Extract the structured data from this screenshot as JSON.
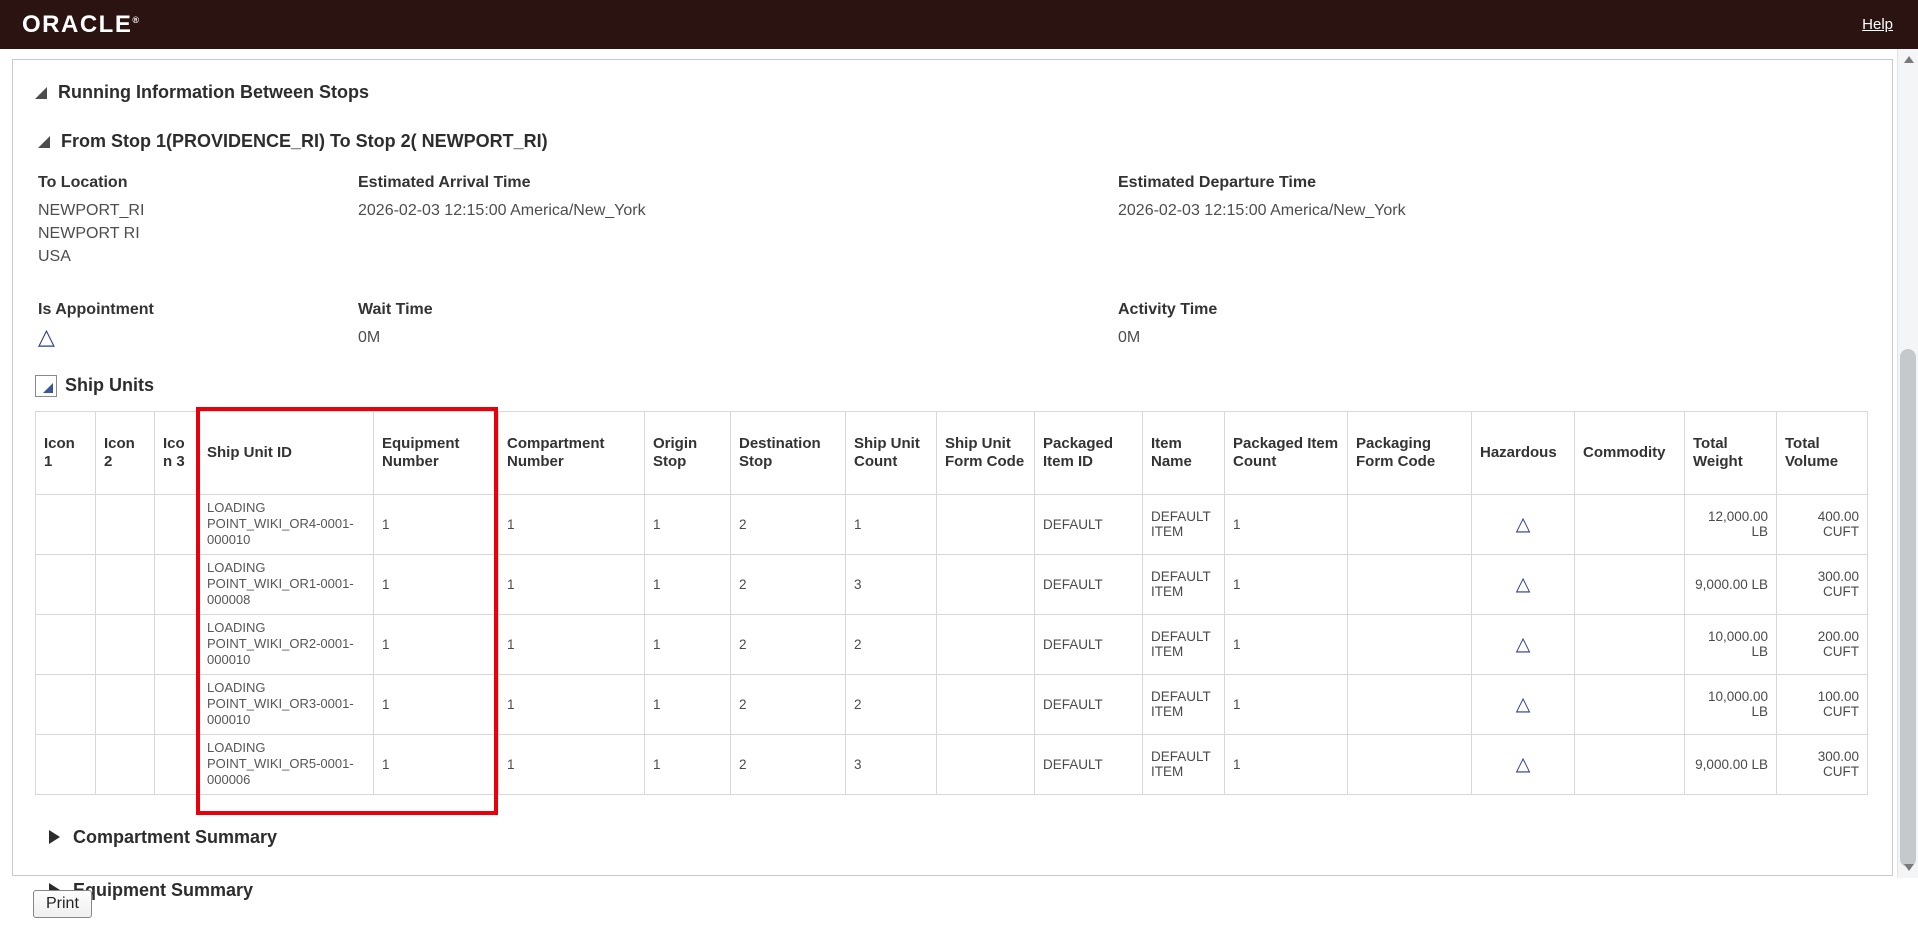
{
  "header": {
    "brand": "ORACLE",
    "registered": "®",
    "help": "Help"
  },
  "sections": {
    "running_info": "Running Information Between Stops",
    "stops": "From Stop 1(PROVIDENCE_RI) To Stop 2( NEWPORT_RI)",
    "ship_units": "Ship Units",
    "compartment_summary": "Compartment Summary",
    "equipment_summary": "Equipment Summary"
  },
  "details": {
    "to_location": {
      "label": "To Location",
      "lines": [
        "NEWPORT_RI",
        "NEWPORT RI",
        "USA"
      ]
    },
    "estimated_arrival": {
      "label": "Estimated Arrival Time",
      "value": "2026-02-03 12:15:00 America/New_York"
    },
    "estimated_departure": {
      "label": "Estimated Departure Time",
      "value": "2026-02-03 12:15:00 America/New_York"
    },
    "is_appointment": {
      "label": "Is Appointment",
      "icon": "triangle"
    },
    "wait_time": {
      "label": "Wait Time",
      "value": "0M"
    },
    "activity_time": {
      "label": "Activity Time",
      "value": "0M"
    }
  },
  "icons": {
    "triangle": "△"
  },
  "table": {
    "columns": [
      "Icon 1",
      "Icon 2",
      "Icon 3",
      "Ship Unit ID",
      "Equipment Number",
      "Compartment Number",
      "Origin Stop",
      "Destination Stop",
      "Ship Unit Count",
      "Ship Unit Form Code",
      "Packaged Item ID",
      "Item Name",
      "Packaged Item Count",
      "Packaging Form Code",
      "Hazardous",
      "Commodity",
      "Total Weight",
      "Total Volume"
    ],
    "rows": [
      {
        "icon1": "",
        "icon2": "",
        "icon3": "",
        "ship_unit_id": "LOADING POINT_WIKI_OR4-0001-000010",
        "equipment_number": "1",
        "compartment_number": "1",
        "origin_stop": "1",
        "destination_stop": "2",
        "ship_unit_count": "1",
        "ship_unit_form_code": "",
        "packaged_item_id": "DEFAULT",
        "item_name": "DEFAULT ITEM",
        "packaged_item_count": "1",
        "packaging_form_code": "",
        "hazardous_icon": "triangle",
        "commodity": "",
        "total_weight": "12,000.00 LB",
        "total_volume": "400.00 CUFT"
      },
      {
        "icon1": "",
        "icon2": "",
        "icon3": "",
        "ship_unit_id": "LOADING POINT_WIKI_OR1-0001-000008",
        "equipment_number": "1",
        "compartment_number": "1",
        "origin_stop": "1",
        "destination_stop": "2",
        "ship_unit_count": "3",
        "ship_unit_form_code": "",
        "packaged_item_id": "DEFAULT",
        "item_name": "DEFAULT ITEM",
        "packaged_item_count": "1",
        "packaging_form_code": "",
        "hazardous_icon": "triangle",
        "commodity": "",
        "total_weight": "9,000.00 LB",
        "total_volume": "300.00 CUFT"
      },
      {
        "icon1": "",
        "icon2": "",
        "icon3": "",
        "ship_unit_id": "LOADING POINT_WIKI_OR2-0001-000010",
        "equipment_number": "1",
        "compartment_number": "1",
        "origin_stop": "1",
        "destination_stop": "2",
        "ship_unit_count": "2",
        "ship_unit_form_code": "",
        "packaged_item_id": "DEFAULT",
        "item_name": "DEFAULT ITEM",
        "packaged_item_count": "1",
        "packaging_form_code": "",
        "hazardous_icon": "triangle",
        "commodity": "",
        "total_weight": "10,000.00 LB",
        "total_volume": "200.00 CUFT"
      },
      {
        "icon1": "",
        "icon2": "",
        "icon3": "",
        "ship_unit_id": "LOADING POINT_WIKI_OR3-0001-000010",
        "equipment_number": "1",
        "compartment_number": "1",
        "origin_stop": "1",
        "destination_stop": "2",
        "ship_unit_count": "2",
        "ship_unit_form_code": "",
        "packaged_item_id": "DEFAULT",
        "item_name": "DEFAULT ITEM",
        "packaged_item_count": "1",
        "packaging_form_code": "",
        "hazardous_icon": "triangle",
        "commodity": "",
        "total_weight": "10,000.00 LB",
        "total_volume": "100.00 CUFT"
      },
      {
        "icon1": "",
        "icon2": "",
        "icon3": "",
        "ship_unit_id": "LOADING POINT_WIKI_OR5-0001-000006",
        "equipment_number": "1",
        "compartment_number": "1",
        "origin_stop": "1",
        "destination_stop": "2",
        "ship_unit_count": "3",
        "ship_unit_form_code": "",
        "packaged_item_id": "DEFAULT",
        "item_name": "DEFAULT ITEM",
        "packaged_item_count": "1",
        "packaging_form_code": "",
        "hazardous_icon": "triangle",
        "commodity": "",
        "total_weight": "9,000.00 LB",
        "total_volume": "300.00 CUFT"
      }
    ]
  },
  "footer": {
    "print": "Print"
  }
}
